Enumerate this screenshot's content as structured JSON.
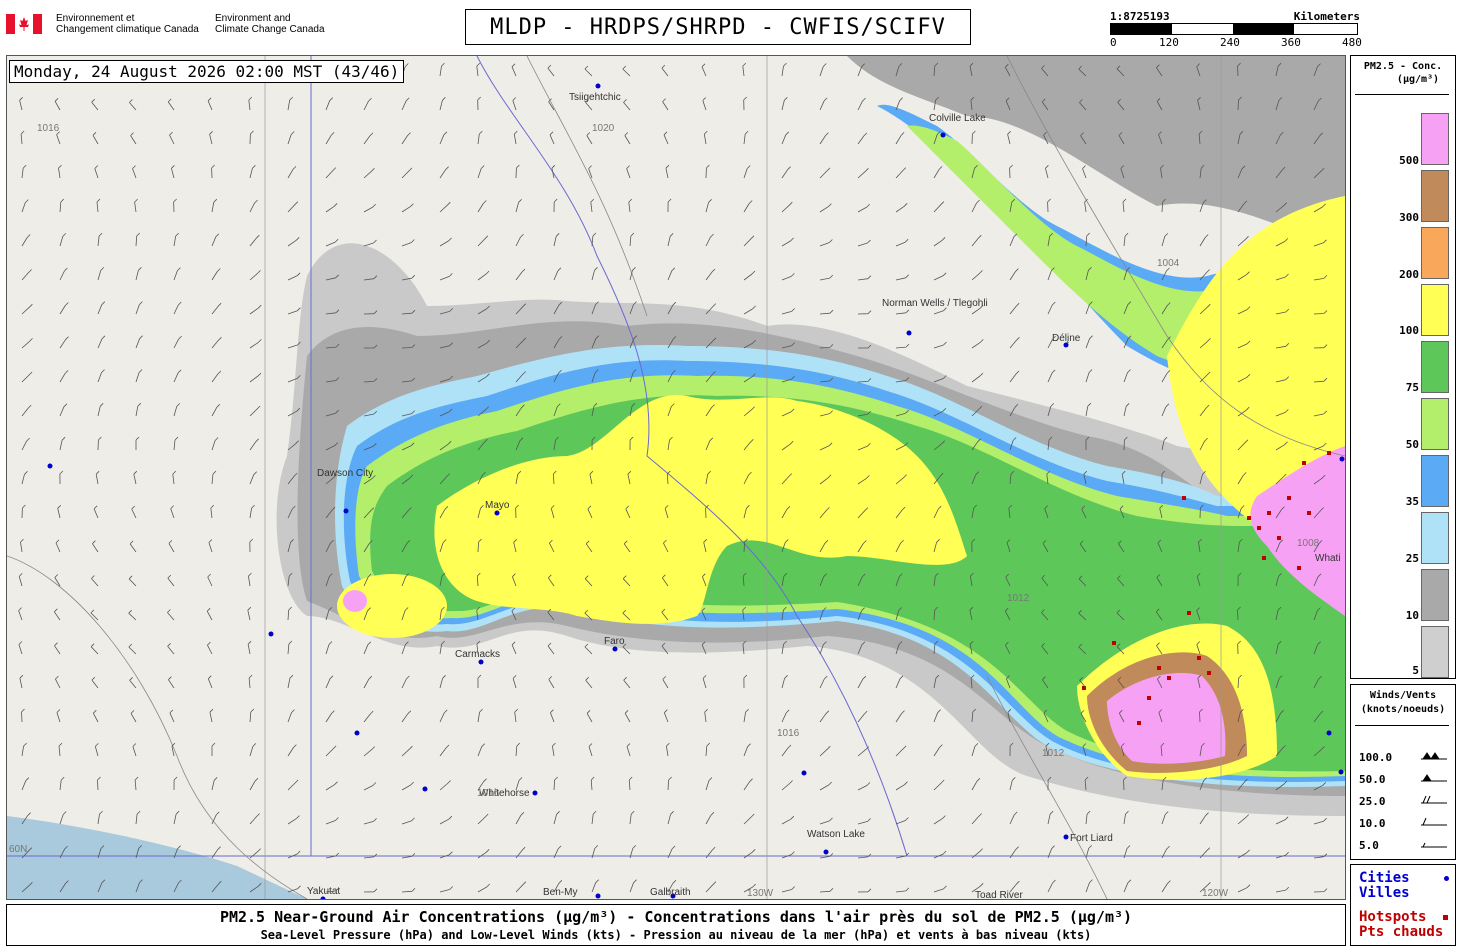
{
  "header": {
    "org_fr_line1": "Environnement et",
    "org_fr_line2": "Changement climatique Canada",
    "org_en_line1": "Environment and",
    "org_en_line2": "Climate Change Canada",
    "title": "MLDP - HRDPS/SHRPD - CWFIS/SCIFV"
  },
  "scale": {
    "ratio": "1:8725193",
    "unit": "Kilometers",
    "ticks": [
      "0",
      "120",
      "240",
      "360",
      "480"
    ]
  },
  "timestamp": "Monday, 24 August 2026 02:00 MST (43/46)",
  "footer": {
    "line1": "PM2.5 Near-Ground Air Concentrations (µg/m³) - Concentrations dans l'air près du sol de PM2.5 (µg/m³)",
    "line2": "Sea-Level Pressure (hPa) and Low-Level Winds (kts) - Pression au niveau de la mer (hPa) et vents à bas niveau (kts)"
  },
  "legend_conc": {
    "title_line1": "PM2.5 - Conc.",
    "title_line2": "(µg/m³)",
    "levels": [
      {
        "label": "500",
        "color": "#f7a1f5"
      },
      {
        "label": "300",
        "color": "#c08a5a"
      },
      {
        "label": "200",
        "color": "#f9a75a"
      },
      {
        "label": "100",
        "color": "#ffff55"
      },
      {
        "label": "75",
        "color": "#5ec75a"
      },
      {
        "label": "50",
        "color": "#b3ef6a"
      },
      {
        "label": "35",
        "color": "#5aaaf5"
      },
      {
        "label": "25",
        "color": "#b0e2f7"
      },
      {
        "label": "10",
        "color": "#a9a9a9"
      },
      {
        "label": "5",
        "color": "#cfcfcf"
      }
    ]
  },
  "legend_wind": {
    "title_line1": "Winds/Vents",
    "title_line2": "(knots/noeuds)",
    "rows": [
      "100.0",
      "50.0",
      "25.0",
      "10.0",
      "5.0"
    ]
  },
  "legend_cities": {
    "cities": "Cities",
    "villes": "Villes",
    "hotspots": "Hotspots",
    "pts": "Pts chauds"
  },
  "map": {
    "places": [
      {
        "name": "Tsiigehtchic"
      },
      {
        "name": "Colville Lake"
      },
      {
        "name": "Norman Wells / Tlegohli"
      },
      {
        "name": "Délįne"
      },
      {
        "name": "Dawson City"
      },
      {
        "name": "Mayo"
      },
      {
        "name": "Faro"
      },
      {
        "name": "Carmacks"
      },
      {
        "name": "Whitehorse"
      },
      {
        "name": "Watson Lake"
      },
      {
        "name": "Fort Liard"
      },
      {
        "name": "Yakutat"
      },
      {
        "name": "Ben-My"
      },
      {
        "name": "Galbraith"
      },
      {
        "name": "Toad River"
      },
      {
        "name": "Whati"
      }
    ],
    "isobar_labels": [
      "1016",
      "1020",
      "1012",
      "1008",
      "1004"
    ],
    "graticule_labels": [
      "60N",
      "130W",
      "120W"
    ]
  }
}
